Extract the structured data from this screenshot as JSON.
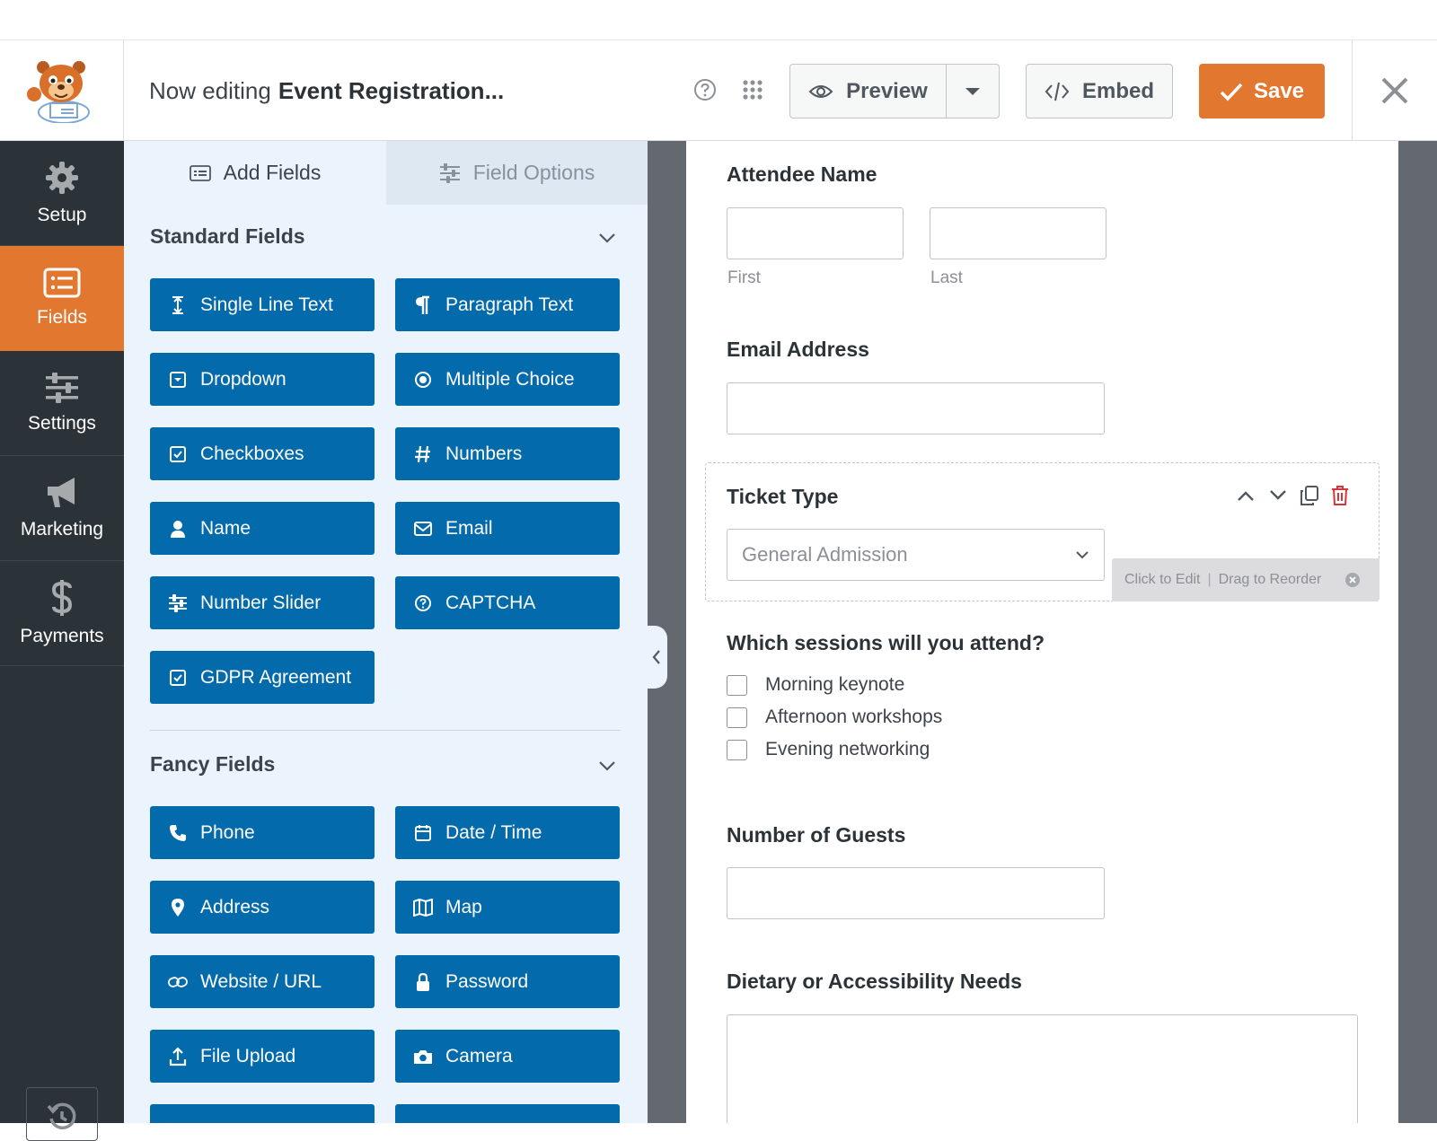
{
  "header": {
    "editing_prefix": "Now editing",
    "form_name": "Event Registration...",
    "preview_label": "Preview",
    "embed_label": "Embed",
    "save_label": "Save"
  },
  "sidebar": {
    "items": [
      {
        "label": "Setup",
        "icon": "gear-icon"
      },
      {
        "label": "Fields",
        "icon": "list-icon",
        "active": true
      },
      {
        "label": "Settings",
        "icon": "sliders-icon"
      },
      {
        "label": "Marketing",
        "icon": "megaphone-icon"
      },
      {
        "label": "Payments",
        "icon": "dollar-icon"
      }
    ]
  },
  "panel": {
    "tabs": {
      "add_fields": "Add Fields",
      "field_options": "Field Options"
    },
    "standard_title": "Standard Fields",
    "standard_fields": [
      {
        "label": "Single Line Text",
        "icon": "text-cursor-icon"
      },
      {
        "label": "Paragraph Text",
        "icon": "paragraph-icon"
      },
      {
        "label": "Dropdown",
        "icon": "dropdown-icon"
      },
      {
        "label": "Multiple Choice",
        "icon": "radio-icon"
      },
      {
        "label": "Checkboxes",
        "icon": "checkbox-icon"
      },
      {
        "label": "Numbers",
        "icon": "hash-icon"
      },
      {
        "label": "Name",
        "icon": "user-icon"
      },
      {
        "label": "Email",
        "icon": "envelope-icon"
      },
      {
        "label": "Number Slider",
        "icon": "sliders-icon"
      },
      {
        "label": "CAPTCHA",
        "icon": "question-icon"
      },
      {
        "label": "GDPR Agreement",
        "icon": "checkbox-icon"
      }
    ],
    "fancy_title": "Fancy Fields",
    "fancy_fields": [
      {
        "label": "Phone",
        "icon": "phone-icon"
      },
      {
        "label": "Date / Time",
        "icon": "calendar-icon"
      },
      {
        "label": "Address",
        "icon": "map-pin-icon"
      },
      {
        "label": "Map",
        "icon": "map-icon"
      },
      {
        "label": "Website / URL",
        "icon": "link-icon"
      },
      {
        "label": "Password",
        "icon": "lock-icon"
      },
      {
        "label": "File Upload",
        "icon": "upload-icon"
      },
      {
        "label": "Camera",
        "icon": "camera-icon"
      }
    ]
  },
  "form": {
    "attendee_label": "Attendee Name",
    "first_sub": "First",
    "last_sub": "Last",
    "email_label": "Email Address",
    "ticket_label": "Ticket Type",
    "ticket_value": "General Admission",
    "edit_tip": "Click to Edit",
    "reorder_tip": "Drag to Reorder",
    "sessions_label": "Which sessions will you attend?",
    "sessions": [
      "Morning keynote",
      "Afternoon workshops",
      "Evening networking"
    ],
    "guests_label": "Number of Guests",
    "dietary_label": "Dietary or Accessibility Needs"
  },
  "colors": {
    "accent": "#e27730",
    "field_button": "#036aab",
    "sidebar": "#2c3338",
    "panel": "#ebf3fc"
  }
}
